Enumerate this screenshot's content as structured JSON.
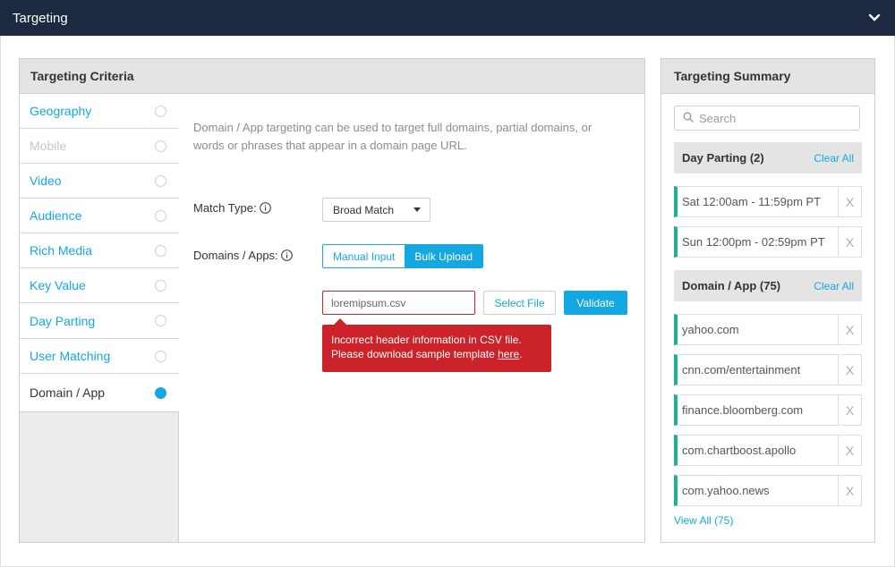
{
  "topbar": {
    "title": "Targeting"
  },
  "criteria": {
    "title": "Targeting Criteria",
    "nav": [
      {
        "label": "Geography",
        "state": "enabled"
      },
      {
        "label": "Mobile",
        "state": "disabled"
      },
      {
        "label": "Video",
        "state": "enabled"
      },
      {
        "label": "Audience",
        "state": "enabled"
      },
      {
        "label": "Rich Media",
        "state": "enabled"
      },
      {
        "label": "Key Value",
        "state": "enabled"
      },
      {
        "label": "Day Parting",
        "state": "enabled"
      },
      {
        "label": "User Matching",
        "state": "enabled"
      },
      {
        "label": "Domain / App",
        "state": "active"
      }
    ],
    "description": "Domain / App targeting can be used to target full domains, partial domains, or words or phrases that appear in a domain page URL.",
    "match_type_label": "Match Type:",
    "match_type_value": "Broad Match",
    "domains_label": "Domains / Apps:",
    "input_modes": [
      "Manual Input",
      "Bulk Upload"
    ],
    "selected_mode": "Bulk Upload",
    "file_value": "loremipsum.csv",
    "select_file_label": "Select File",
    "validate_label": "Validate",
    "error_line1": "Incorrect header information in CSV file.",
    "error_line2_prefix": "Please download sample template ",
    "error_link": "here",
    "error_suffix": "."
  },
  "summary": {
    "title": "Targeting Summary",
    "search_placeholder": "Search",
    "groups": [
      {
        "title": "Day Parting (2)",
        "clear_label": "Clear All",
        "items": [
          "Sat 12:00am - 11:59pm PT",
          "Sun 12:00pm - 02:59pm PT"
        ]
      },
      {
        "title": "Domain / App (75)",
        "clear_label": "Clear All",
        "items": [
          "yahoo.com",
          "cnn.com/entertainment",
          "finance.bloomberg.com",
          "com.chartboost.apollo",
          "com.yahoo.news"
        ]
      }
    ],
    "remove_label": "X",
    "view_all": "View All (75)"
  },
  "colors": {
    "accent": "#13a8e2",
    "topbar": "#1d2940",
    "error": "#cc2229",
    "chip_bar": "#1ab394"
  },
  "icons": {
    "collapse": "chevron-down-icon",
    "info": "info-icon",
    "search": "search-icon",
    "dropdown": "caret-down-icon"
  }
}
